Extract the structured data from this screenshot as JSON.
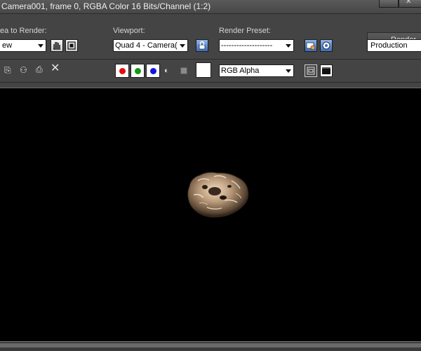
{
  "window": {
    "title": "Camera001, frame 0, RGBA Color 16 Bits/Channel (1:2)"
  },
  "area_to_render": {
    "label": "ea to Render:",
    "value": "ew"
  },
  "viewport": {
    "label": "Viewport:",
    "value": "Quad 4 - Camera("
  },
  "render_preset": {
    "label": "Render Preset:",
    "value": "--------------------"
  },
  "render": {
    "button_label": "Render",
    "mode_value": "Production"
  },
  "display": {
    "channel_value": "RGB Alpha"
  },
  "colors": {
    "red_channel": "#e01010",
    "green_channel": "#129a12",
    "blue_channel": "#1616d8",
    "background": "#000000"
  }
}
